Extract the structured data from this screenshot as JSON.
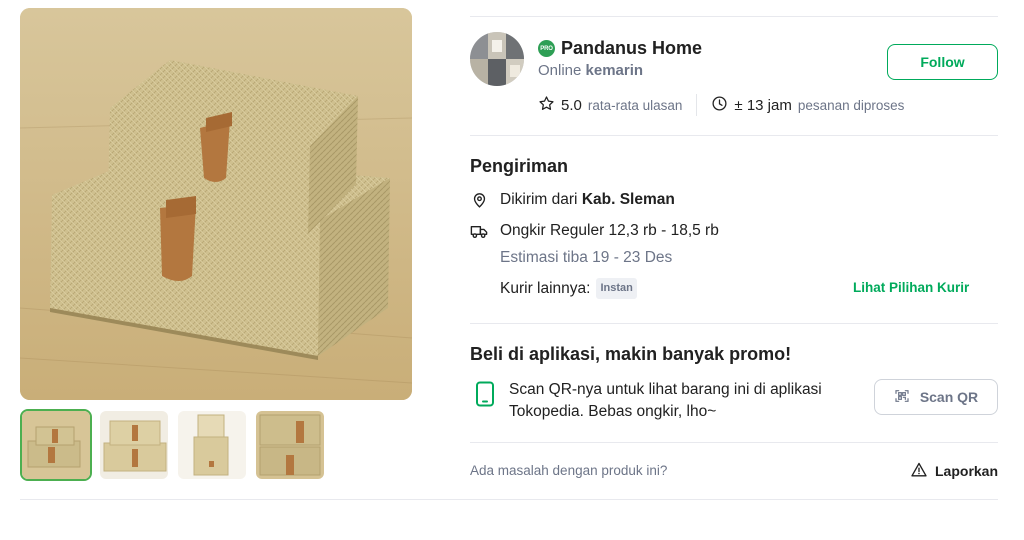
{
  "gallery": {
    "main_image": "woven pandanus storage boxes with leather tab",
    "thumbnails": [
      {
        "subject": "two stacked woven boxes",
        "selected": true
      },
      {
        "subject": "two stacked woven boxes, light background",
        "selected": false
      },
      {
        "subject": "open woven box",
        "selected": false
      },
      {
        "subject": "close-up of woven box with leather tab",
        "selected": false
      }
    ]
  },
  "shop": {
    "badge": "PRO",
    "name": "Pandanus Home",
    "online_prefix": "Online",
    "online_value": "kemarin",
    "follow_label": "Follow",
    "rating_value": "5.0",
    "rating_label": "rata-rata ulasan",
    "process_value": "± 13 jam",
    "process_label": "pesanan diproses"
  },
  "shipping": {
    "title": "Pengiriman",
    "from_prefix": "Dikirim dari",
    "from_location": "Kab. Sleman",
    "ongkir_text": "Ongkir Reguler 12,3 rb - 18,5 rb",
    "estimate_text": "Estimasi tiba 19 - 23 Des",
    "other_kurir_label": "Kurir lainnya:",
    "instan_tag": "Instan",
    "lihat_link": "Lihat Pilihan Kurir"
  },
  "app_promo": {
    "title": "Beli di aplikasi, makin banyak promo!",
    "text": "Scan QR-nya untuk lihat barang ini di aplikasi Tokopedia. Bebas ongkir, lho~",
    "scan_label": "Scan QR"
  },
  "report": {
    "question": "Ada masalah dengan produk ini?",
    "button_label": "Laporkan"
  },
  "colors": {
    "accent_green": "#00aa5b",
    "text_primary": "#212121",
    "text_muted": "#6d7588",
    "divider": "#e8e9ee"
  },
  "icons": {
    "rating": "star-outline-icon",
    "process": "clock-icon",
    "location": "location-pin-icon",
    "courier": "delivery-truck-icon",
    "phone": "smartphone-icon",
    "qr": "qr-scan-icon",
    "report": "warning-triangle-icon"
  }
}
